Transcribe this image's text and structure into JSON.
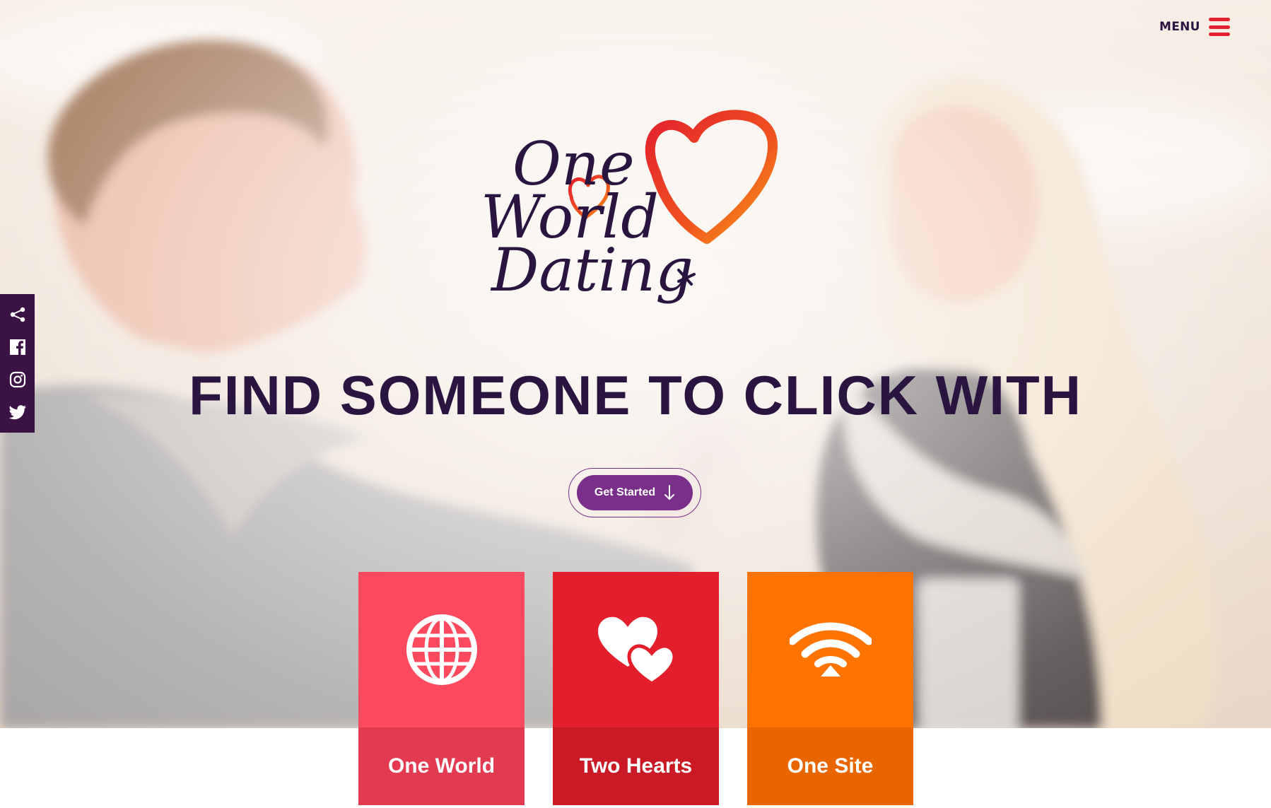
{
  "header": {
    "menu_label": "MENU"
  },
  "social": {
    "items": [
      {
        "name": "Share",
        "icon": "share-icon"
      },
      {
        "name": "Facebook",
        "icon": "facebook-icon"
      },
      {
        "name": "Instagram",
        "icon": "instagram-icon"
      },
      {
        "name": "Twitter",
        "icon": "twitter-icon"
      }
    ]
  },
  "logo": {
    "line1": "One",
    "line2": "World",
    "line3": "Dating"
  },
  "hero": {
    "headline": "FIND SOMEONE TO CLICK WITH",
    "cta_label": "Get Started",
    "cta_icon": "arrow-down-icon"
  },
  "tiles": [
    {
      "label": "One World",
      "icon": "globe-icon",
      "color_top": "#fe4a5f",
      "color_bottom": "#e23a50"
    },
    {
      "label": "Two Hearts",
      "icon": "two-hearts-icon",
      "color_top": "#e31f2c",
      "color_bottom": "#c91a26"
    },
    {
      "label": "One Site",
      "icon": "wifi-icon",
      "color_top": "#ff7300",
      "color_bottom": "#e96500"
    }
  ],
  "colors": {
    "brand_purple": "#2a1540",
    "cta_purple": "#7a2f8a",
    "menu_red": "#e3202e",
    "social_bar": "#3a1244"
  }
}
